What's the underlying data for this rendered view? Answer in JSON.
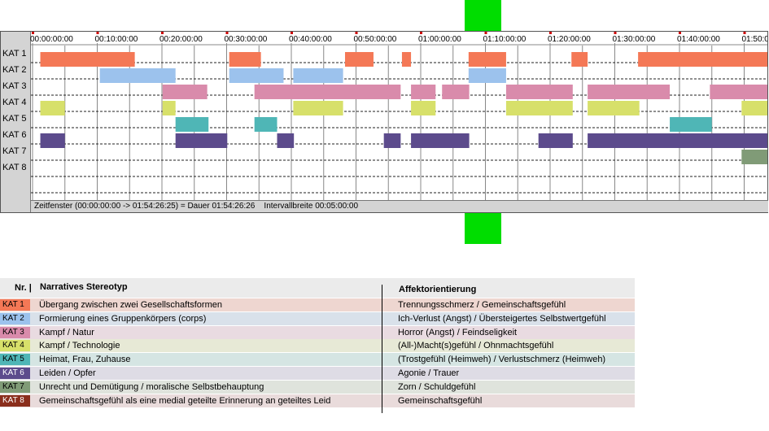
{
  "colors": {
    "marker": "#00dd00",
    "panel_bg": "#d4d4d4",
    "KAT 1": "#f47856",
    "KAT 2": "#9cc2ed",
    "KAT 3": "#d98bab",
    "KAT 4": "#d7e06a",
    "KAT 5": "#4fb6b6",
    "KAT 6": "#5c4b8c",
    "KAT 7": "#809b77",
    "KAT 8": "#8a2e1c"
  },
  "timeline": {
    "status_text": "Zeitfenster (00:00:00:00 -> 01:54:26:25) = Dauer 01:54:26:26    Intervallbreite 00:05:00:00"
  },
  "chart_data": {
    "type": "timeline",
    "x_unit": "minutes",
    "xlim": [
      0,
      114.44
    ],
    "tick_labels": [
      "00:00:00:00",
      "00:10:00:00",
      "00:20:00:00",
      "00:30:00:00",
      "00:40:00:00",
      "00:50:00:00",
      "01:00:00:00",
      "01:10:00:00",
      "01:20:00:00",
      "01:30:00:00",
      "01:40:00:00",
      "01:50:0"
    ],
    "major_ticks_min": [
      0,
      10,
      20,
      30,
      40,
      50,
      60,
      70,
      80,
      90,
      100,
      110
    ],
    "minor_ticks_min": [
      5,
      15,
      25,
      35,
      45,
      55,
      65,
      75,
      85,
      95,
      105
    ],
    "categories": [
      "KAT 1",
      "KAT 2",
      "KAT 3",
      "KAT 4",
      "KAT 5",
      "KAT 6",
      "KAT 7",
      "KAT 8"
    ],
    "segments": {
      "KAT 1": [
        [
          1.2,
          15.8
        ],
        [
          30.4,
          35.3
        ],
        [
          48.3,
          52.7
        ],
        [
          57.1,
          58.5
        ],
        [
          67.4,
          73.2
        ],
        [
          83.3,
          85.8
        ],
        [
          93.6,
          114.3
        ]
      ],
      "KAT 2": [
        [
          10.4,
          22.1
        ],
        [
          30.4,
          38.8
        ],
        [
          40.3,
          48.0
        ],
        [
          67.4,
          73.2
        ]
      ],
      "KAT 3": [
        [
          20.1,
          27.0
        ],
        [
          34.3,
          56.9
        ],
        [
          58.5,
          62.3
        ],
        [
          63.3,
          67.5
        ],
        [
          73.2,
          83.5
        ],
        [
          85.8,
          98.5
        ],
        [
          104.7,
          114.3
        ]
      ],
      "KAT 4": [
        [
          1.2,
          5.0
        ],
        [
          20.1,
          22.1
        ],
        [
          40.3,
          48.0
        ],
        [
          58.5,
          62.3
        ],
        [
          73.2,
          83.5
        ],
        [
          85.8,
          93.8
        ],
        [
          109.6,
          114.3
        ]
      ],
      "KAT 5": [
        [
          22.1,
          27.2
        ],
        [
          34.3,
          37.8
        ],
        [
          98.5,
          105.0
        ]
      ],
      "KAT 6": [
        [
          1.2,
          5.0
        ],
        [
          22.1,
          30.1
        ],
        [
          37.8,
          40.4
        ],
        [
          54.3,
          56.9
        ],
        [
          58.5,
          67.5
        ],
        [
          78.2,
          83.5
        ],
        [
          85.8,
          114.3
        ]
      ],
      "KAT 7": [
        [
          109.6,
          114.3
        ]
      ],
      "KAT 8": []
    }
  },
  "legend": {
    "header": {
      "nr": "Nr. |",
      "stereotyp": "Narratives Stereotyp",
      "affekt": "Affektorientierung"
    },
    "rows": [
      {
        "kat": "KAT 1",
        "stereotyp": "Übergang zwischen zwei Gesellschaftsformen",
        "affekt": "Trennungsschmerz / Gemeinschaftsgefühl",
        "bg": "#eed6d0"
      },
      {
        "kat": "KAT 2",
        "stereotyp": "Formierung eines Gruppenkörpers (corps)",
        "affekt": "Ich-Verlust (Angst) / Übersteigertes Selbstwertgefühl",
        "bg": "#d9e1ea"
      },
      {
        "kat": "KAT 3",
        "stereotyp": "Kampf / Natur",
        "affekt": "Horror (Angst) / Feindseligkeit",
        "bg": "#e9dbe1"
      },
      {
        "kat": "KAT 4",
        "stereotyp": "Kampf / Technologie",
        "affekt": "(All-)Macht(s)gefühl / Ohnmachtsgefühl",
        "bg": "#e7e9d6"
      },
      {
        "kat": "KAT 5",
        "stereotyp": "Heimat, Frau, Zuhause",
        "affekt": "(Trostgefühl (Heimweh) / Verlustschmerz (Heimweh)",
        "bg": "#d5e5e3"
      },
      {
        "kat": "KAT 6",
        "stereotyp": "Leiden / Opfer",
        "affekt": "Agonie / Trauer",
        "bg": "#dedce5"
      },
      {
        "kat": "KAT 7",
        "stereotyp": "Unrecht und Demütigung / moralische Selbstbehauptung",
        "affekt": "Zorn / Schuldgefühl",
        "bg": "#dfe3dc"
      },
      {
        "kat": "KAT 8",
        "stereotyp": "Gemeinschaftsgefühl als eine medial geteilte Erinnerung an geteiltes Leid",
        "affekt": "Gemeinschaftsgefühl",
        "bg": "#e9dbdb"
      }
    ]
  }
}
